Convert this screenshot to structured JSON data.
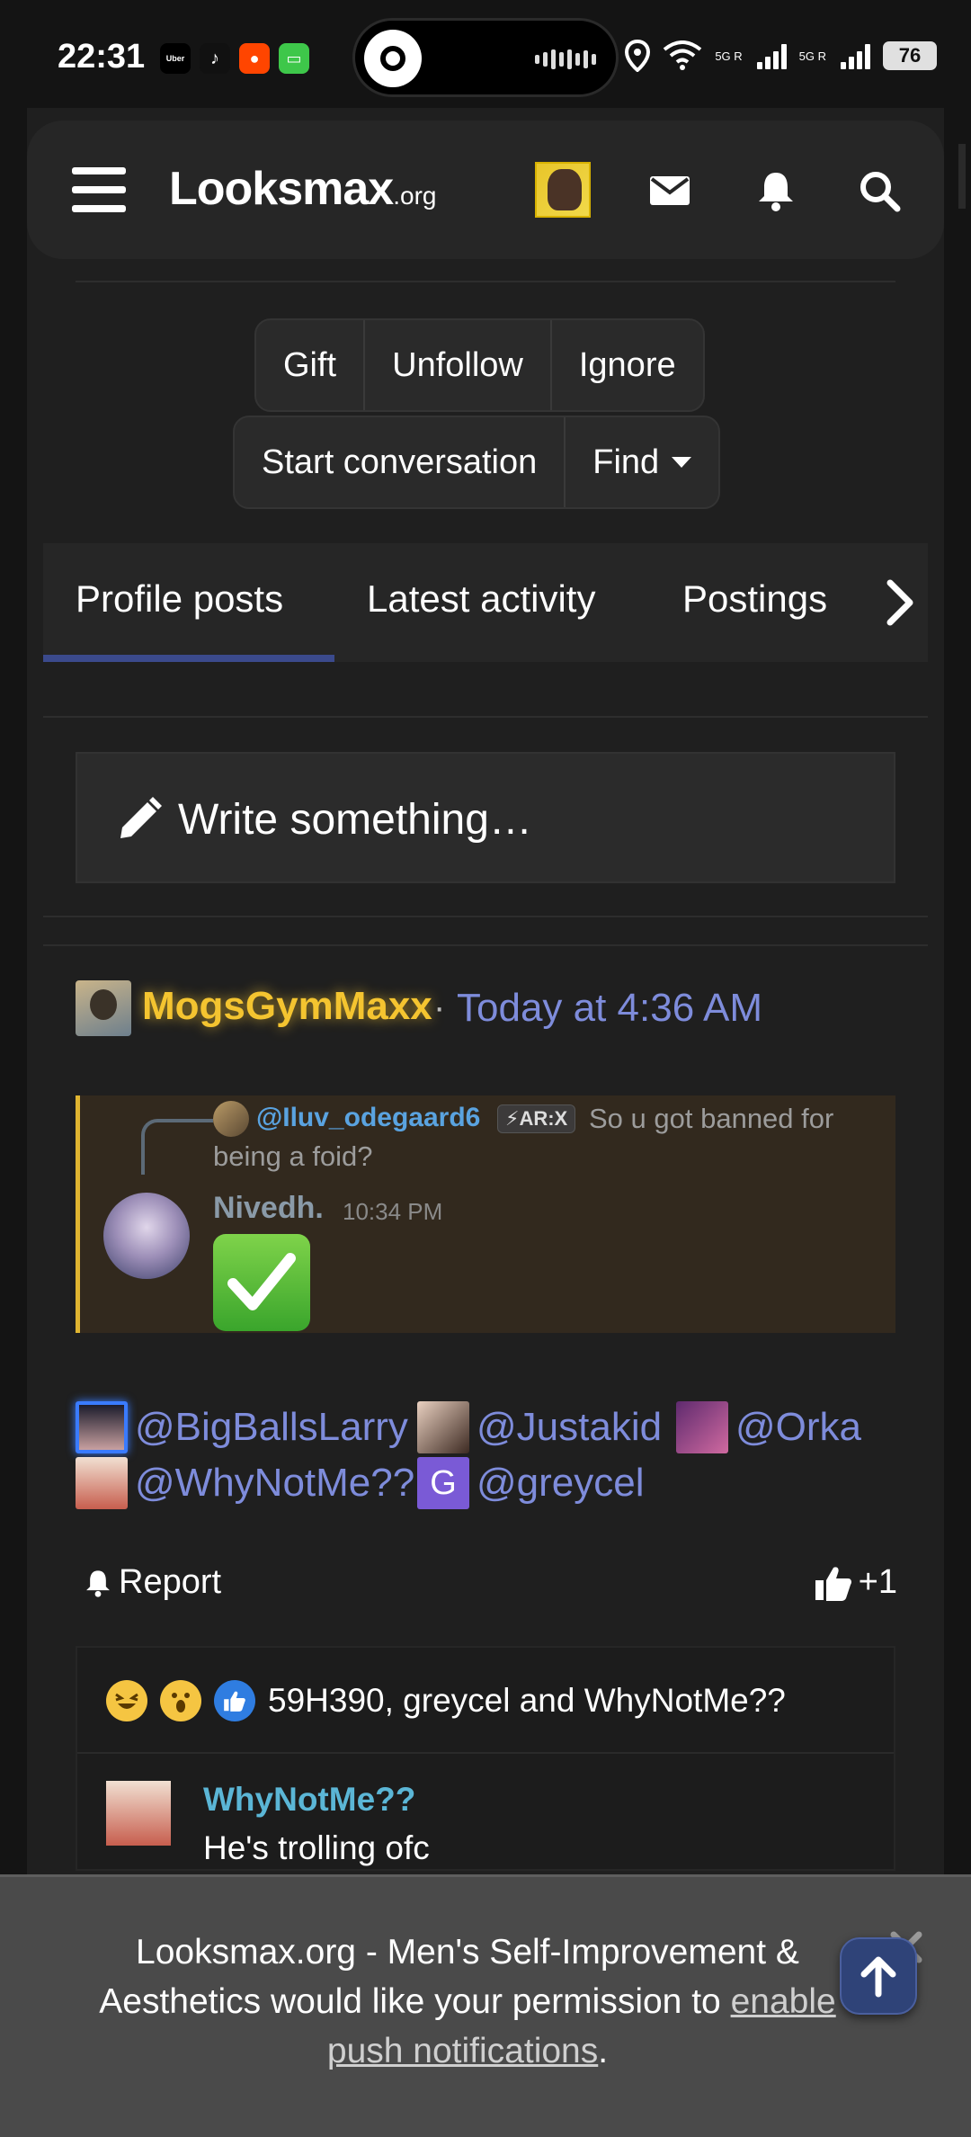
{
  "status_bar": {
    "time": "22:31",
    "apps": [
      {
        "icon": "uber-icon",
        "label": "Uber",
        "color": "#000000"
      },
      {
        "icon": "tiktok-icon",
        "label": "♪",
        "color": "#111111"
      },
      {
        "icon": "reddit-icon",
        "label": "●",
        "color": "#ff4500"
      },
      {
        "icon": "messages-icon",
        "label": "▭",
        "color": "#3ec74a"
      }
    ],
    "signal_labels": [
      "5G R",
      "5G R"
    ],
    "battery": "76"
  },
  "header": {
    "logo_main": "Looksmax",
    "logo_suffix": ".org"
  },
  "profile_actions": {
    "row1": [
      "Gift",
      "Unfollow",
      "Ignore"
    ],
    "row2_conversation": "Start conversation",
    "row2_find": "Find"
  },
  "tabs": {
    "items": [
      "Profile posts",
      "Latest activity",
      "Postings"
    ],
    "active": "Profile posts"
  },
  "write_box": {
    "placeholder": "Write something…"
  },
  "post": {
    "author": "MogsGymMaxx",
    "separator": "·",
    "time": "Today at 4:36 AM",
    "quote": {
      "mention": "@Iluv_odegaard6",
      "badge": "⚡AR:X",
      "text_line1": "So u got banned for",
      "text_line2": "being a foid?",
      "name": "Nivedh.",
      "time": "10:34 PM",
      "emoji": "✓"
    },
    "mentions": [
      "@BigBallsLarry",
      "@Justakid",
      "@Orka",
      "@WhyNotMe??",
      "@greycel"
    ],
    "mention_avatar_letter": "G",
    "report_label": "Report",
    "like_label": "+1",
    "reactions_text": "59H390, greycel and WhyNotMe??",
    "reply": {
      "name": "WhyNotMe??",
      "text": "He's trolling ofc"
    }
  },
  "notification_banner": {
    "text": "Looksmax.org - Men's Self-Improvement & Aesthetics would like your permission to",
    "link": "enable push notifications",
    "period": "."
  },
  "colors": {
    "accent": "#7e8cdb",
    "author_gold": "#f4c430",
    "quote_border": "#e0b531",
    "tab_underline": "#3b4a8c"
  }
}
